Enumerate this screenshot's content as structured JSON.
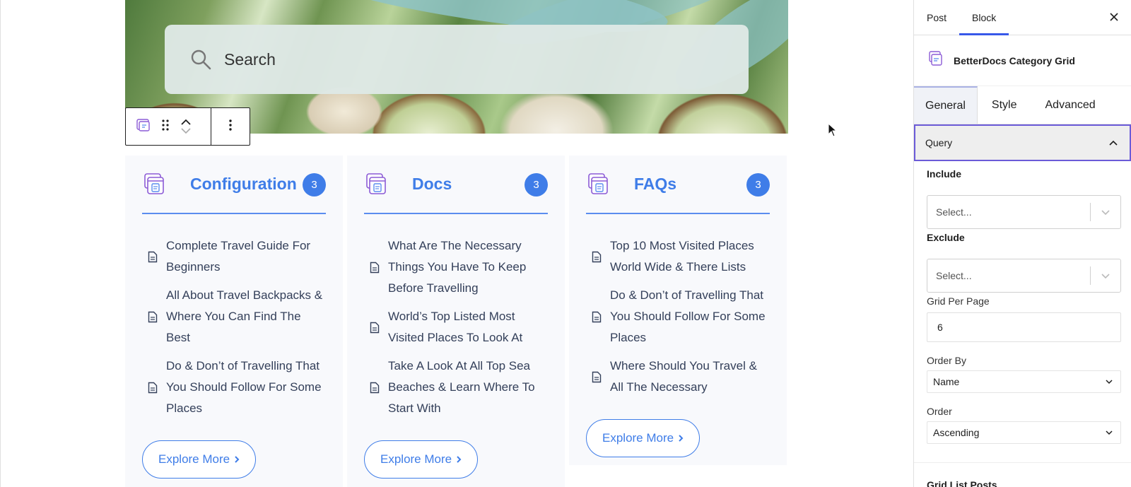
{
  "search": {
    "placeholder": "Search"
  },
  "categories": [
    {
      "title": "Configuration",
      "count": "3",
      "docs": [
        "Complete Travel Guide For Beginners",
        "All About Travel Backpacks & Where You Can Find The Best",
        "Do & Don’t of Travelling That You Should Follow For Some Places"
      ],
      "explore_label": "Explore More"
    },
    {
      "title": "Docs",
      "count": "3",
      "docs": [
        "What Are The Necessary Things You Have To Keep Before Travelling",
        "World’s Top Listed Most Visited Places To Look At",
        "Take A Look At All Top Sea Beaches & Learn Where To Start With"
      ],
      "explore_label": "Explore More"
    },
    {
      "title": "FAQs",
      "count": "3",
      "docs": [
        "Top 10 Most Visited Places World Wide & There Lists",
        "Do & Don’t of Travelling That You Should Follow For Some Places",
        "Where Should You Travel & All The Necessary"
      ],
      "explore_label": "Explore More"
    }
  ],
  "sidebar": {
    "tabs": [
      "Post",
      "Block"
    ],
    "active_tab": "Block",
    "block_name": "BetterDocs Category Grid",
    "panel_tabs": [
      "General",
      "Style",
      "Advanced"
    ],
    "active_panel_tab": "General",
    "query_title": "Query",
    "include_label": "Include",
    "include_placeholder": "Select...",
    "exclude_label": "Exclude",
    "exclude_placeholder": "Select...",
    "grid_per_page_label": "Grid Per Page",
    "grid_per_page_value": "6",
    "order_by_label": "Order By",
    "order_by_value": "Name",
    "order_label": "Order",
    "order_value": "Ascending",
    "grid_list_posts_label": "Grid List Posts"
  },
  "colors": {
    "accent": "#3f7de8",
    "wp_blue": "#3858e9",
    "query_border": "#6b5bd8",
    "card_bg": "#f8f9fc"
  },
  "icons": [
    "search-icon",
    "category-grid-icon",
    "drag-handle-icon",
    "chevron-up-icon",
    "chevron-down-icon",
    "more-options-icon",
    "folder-doc-icon",
    "document-icon",
    "chevron-right-icon",
    "close-icon",
    "mouse-cursor-icon"
  ]
}
